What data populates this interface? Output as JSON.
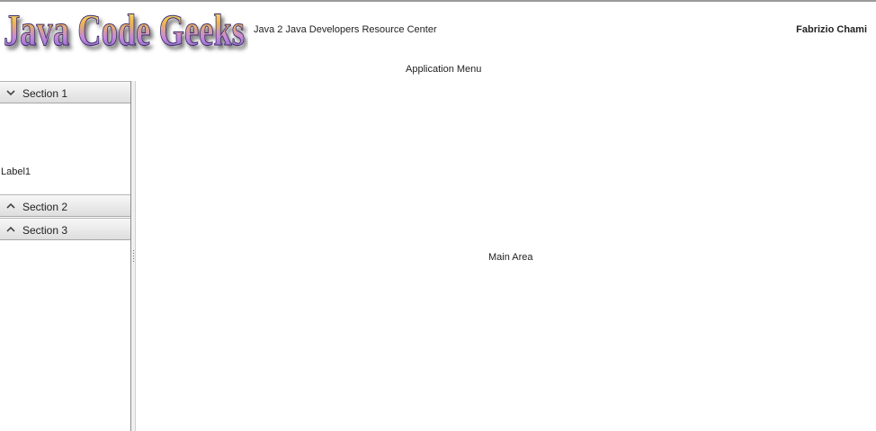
{
  "header": {
    "logo_text": "Java Code Geeks",
    "tagline": "Java 2 Java Developers Resource Center",
    "user_name": "Fabrizio Chami"
  },
  "menu": {
    "label": "Application Menu"
  },
  "sidebar": {
    "sections": [
      {
        "label": "Section 1",
        "expanded": true,
        "icon": "chevron-down-icon"
      },
      {
        "label": "Section 2",
        "expanded": false,
        "icon": "chevron-up-icon"
      },
      {
        "label": "Section 3",
        "expanded": false,
        "icon": "chevron-up-icon"
      }
    ],
    "section1_content": "Label1"
  },
  "main": {
    "label": "Main Area"
  }
}
